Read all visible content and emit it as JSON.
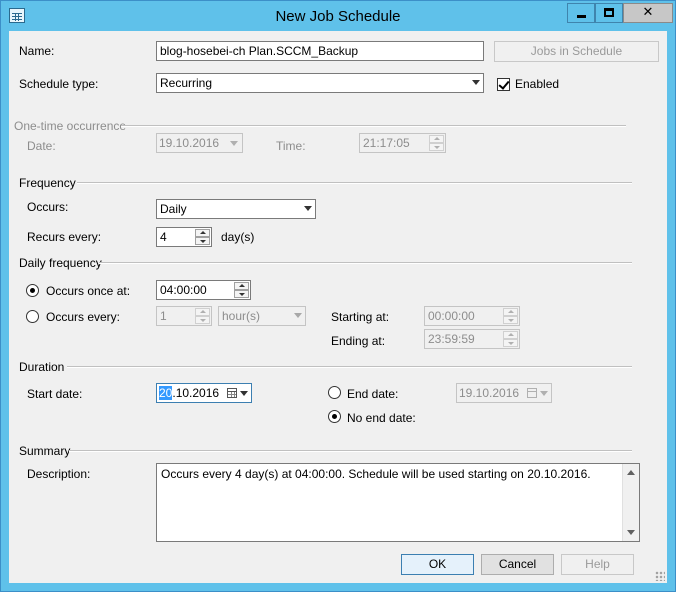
{
  "window": {
    "title": "New Job Schedule"
  },
  "name": {
    "label": "Name:",
    "value": "blog-hosebei-ch Plan.SCCM_Backup",
    "jobs_button": "Jobs in Schedule"
  },
  "schedule_type": {
    "label": "Schedule type:",
    "value": "Recurring",
    "enabled_label": "Enabled",
    "enabled": true
  },
  "one_time": {
    "group": "One-time occurrence",
    "date_label": "Date:",
    "date_value": "19.10.2016",
    "time_label": "Time:",
    "time_value": "21:17:05"
  },
  "frequency": {
    "group": "Frequency",
    "occurs_label": "Occurs:",
    "occurs_value": "Daily",
    "recurs_label": "Recurs every:",
    "recurs_value": "4",
    "recurs_unit": "day(s)"
  },
  "daily_frequency": {
    "group": "Daily frequency",
    "once_label": "Occurs once at:",
    "once_value": "04:00:00",
    "once_selected": true,
    "every_label": "Occurs every:",
    "every_value": "1",
    "every_unit": "hour(s)",
    "starting_label": "Starting at:",
    "starting_value": "00:00:00",
    "ending_label": "Ending at:",
    "ending_value": "23:59:59"
  },
  "duration": {
    "group": "Duration",
    "start_label": "Start date:",
    "start_value_sel": "20",
    "start_value_rest": ".10.2016",
    "end_label": "End date:",
    "end_value": "19.10.2016",
    "no_end_label": "No end date:",
    "no_end_selected": true
  },
  "summary": {
    "group": "Summary",
    "desc_label": "Description:",
    "desc_value": "Occurs every 4 day(s) at 04:00:00. Schedule will be used starting on 20.10.2016."
  },
  "buttons": {
    "ok": "OK",
    "cancel": "Cancel",
    "help": "Help"
  }
}
